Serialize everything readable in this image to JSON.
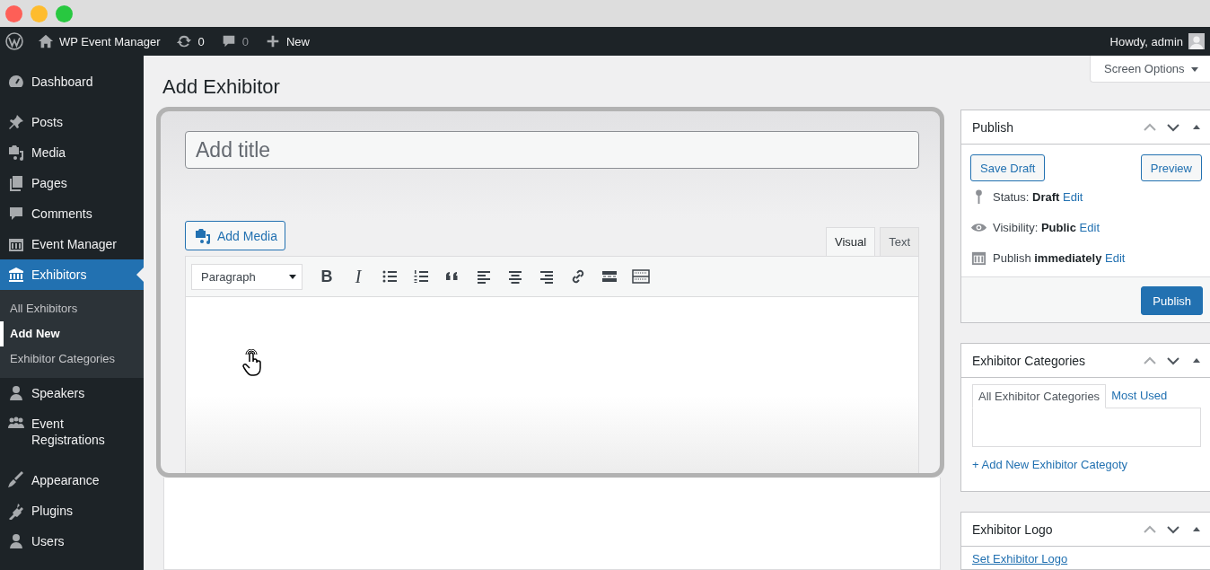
{
  "admin_bar": {
    "site_name": "WP Event Manager",
    "updates": "0",
    "comments": "0",
    "new": "New",
    "greeting": "Howdy, admin"
  },
  "sidebar": {
    "items": [
      {
        "label": "Dashboard",
        "selected": false
      },
      {
        "label": "Posts",
        "selected": false
      },
      {
        "label": "Media",
        "selected": false
      },
      {
        "label": "Pages",
        "selected": false
      },
      {
        "label": "Comments",
        "selected": false
      },
      {
        "label": "Event Manager",
        "selected": false
      },
      {
        "label": "Exhibitors",
        "selected": true,
        "children": [
          {
            "label": "All Exhibitors",
            "selected": false
          },
          {
            "label": "Add New",
            "selected": true
          },
          {
            "label": "Exhibitor Categories",
            "selected": false
          }
        ]
      },
      {
        "label": "Speakers",
        "selected": false
      },
      {
        "label": "Event Registrations",
        "selected": false
      },
      {
        "label": "Appearance",
        "selected": false
      },
      {
        "label": "Plugins",
        "selected": false
      },
      {
        "label": "Users",
        "selected": false
      }
    ]
  },
  "page_title": "Add Exhibitor",
  "screen_options": "Screen Options",
  "title_field": {
    "placeholder": "Add title"
  },
  "add_media": "Add Media",
  "editor_tabs": [
    {
      "label": "Visual",
      "selected": true
    },
    {
      "label": "Text",
      "selected": false
    }
  ],
  "format_select": "Paragraph",
  "toolbar": [
    {
      "kind": "bold",
      "label": "B"
    },
    {
      "kind": "italic",
      "label": "I"
    },
    {
      "kind": "bullets"
    },
    {
      "kind": "numbers"
    },
    {
      "kind": "quote"
    },
    {
      "kind": "align-left"
    },
    {
      "kind": "align-center"
    },
    {
      "kind": "align-right"
    },
    {
      "kind": "link"
    },
    {
      "kind": "more"
    },
    {
      "kind": "kitchen-sink"
    }
  ],
  "publish_box": {
    "title": "Publish",
    "save_draft": "Save Draft",
    "preview": "Preview",
    "rows": [
      {
        "text": "Status: **Draft**",
        "link": "Edit"
      },
      {
        "text": "Visibility: **Public**",
        "link": "Edit"
      },
      {
        "text": "Publish **immediately**",
        "link": "Edit"
      }
    ],
    "publish": "Publish"
  },
  "categories_box": {
    "title": "Exhibitor Categories",
    "tabs": [
      {
        "label": "All Exhibitor Categories",
        "selected": true
      },
      {
        "label": "Most Used",
        "selected": false
      }
    ],
    "add_link": "+ Add New Exhibitor Categoty"
  },
  "logo_box": {
    "title": "Exhibitor Logo",
    "link": "Set Exhibitor Logo"
  }
}
